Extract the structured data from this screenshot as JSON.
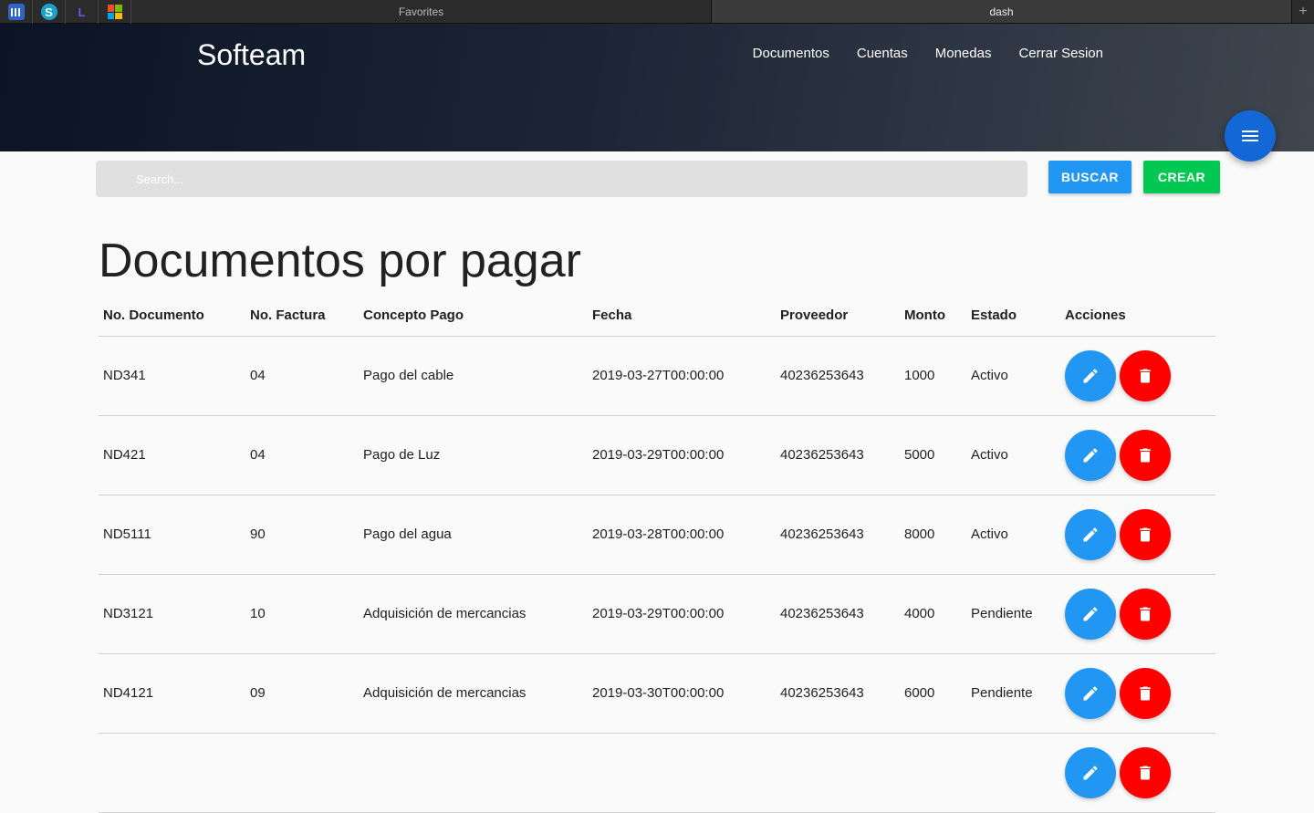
{
  "browser": {
    "tabs": [
      {
        "label": "Favorites",
        "active": false
      },
      {
        "label": "dash",
        "active": true
      }
    ],
    "favicons": [
      "library-icon",
      "s-badge-icon",
      "l-letter-icon",
      "windows-grid-icon"
    ],
    "favicon_letters": {
      "s": "S",
      "l": "L"
    }
  },
  "header": {
    "brand": "Softeam",
    "nav": [
      "Documentos",
      "Cuentas",
      "Monedas",
      "Cerrar Sesion"
    ],
    "fab_icon": "menu-icon",
    "gradient": [
      "#0b1424",
      "#3f4650"
    ]
  },
  "search": {
    "placeholder": "Search...",
    "buscar_label": "BUSCAR",
    "crear_label": "CREAR",
    "buscar_color": "#2196f3",
    "crear_color": "#00c853"
  },
  "page_title": "Documentos por pagar",
  "table": {
    "columns": [
      "No. Documento",
      "No. Factura",
      "Concepto Pago",
      "Fecha",
      "Proveedor",
      "Monto",
      "Estado",
      "Acciones"
    ],
    "rows": [
      [
        "ND341",
        "04",
        "Pago del cable",
        "2019-03-27T00:00:00",
        "40236253643",
        "1000",
        "Activo"
      ],
      [
        "ND421",
        "04",
        "Pago de Luz",
        "2019-03-29T00:00:00",
        "40236253643",
        "5000",
        "Activo"
      ],
      [
        "ND5111",
        "90",
        "Pago del agua",
        "2019-03-28T00:00:00",
        "40236253643",
        "8000",
        "Activo"
      ],
      [
        "ND3121",
        "10",
        "Adquisición de mercancias",
        "2019-03-29T00:00:00",
        "40236253643",
        "4000",
        "Pendiente"
      ],
      [
        "ND4121",
        "09",
        "Adquisición de mercancias",
        "2019-03-30T00:00:00",
        "40236253643",
        "6000",
        "Pendiente"
      ],
      [
        "",
        "",
        "",
        "",
        "",
        "",
        ""
      ]
    ],
    "action_icons": [
      "pencil-icon",
      "trash-icon"
    ],
    "edit_color": "#2196f3",
    "delete_color": "#ff0000"
  }
}
